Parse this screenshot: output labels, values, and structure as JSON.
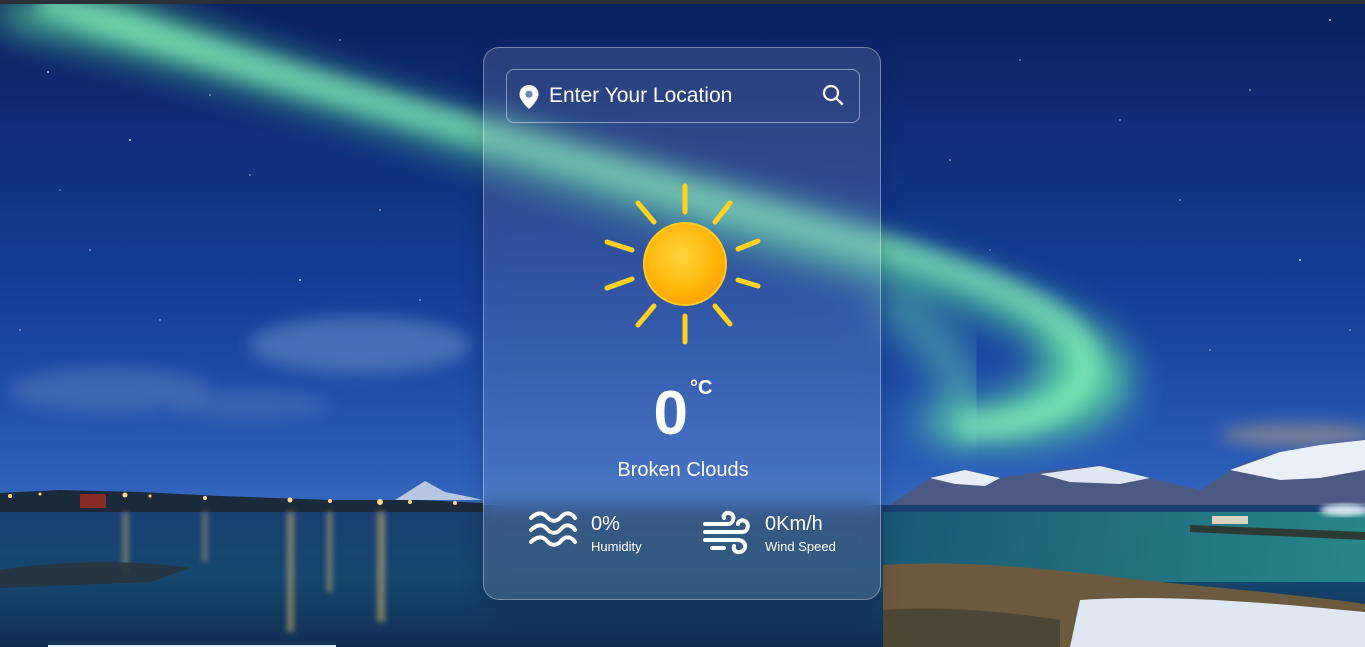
{
  "search": {
    "placeholder": "Enter Your Location",
    "location_icon": "location-pin-icon",
    "search_icon": "magnifier-icon"
  },
  "weather": {
    "icon": "sun-icon",
    "temperature": "0",
    "unit": "°C",
    "description": "Broken Clouds"
  },
  "details": {
    "humidity": {
      "icon": "waves-icon",
      "value": "0%",
      "label": "Humidity"
    },
    "wind": {
      "icon": "wind-icon",
      "value": "0Km/h",
      "label": "Wind Speed"
    }
  },
  "colors": {
    "text": "#ffffff",
    "sun_core": "#ffb40a",
    "sun_rays": "#ffd21f",
    "sky": "#123b8f",
    "aurora": "#5be3a1"
  }
}
